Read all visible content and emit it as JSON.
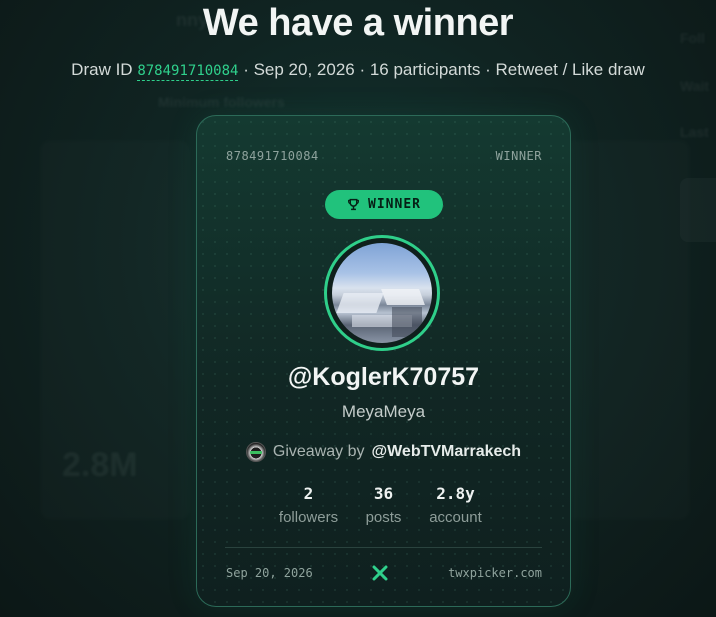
{
  "background_hints": {
    "ghost_1": "nny ac",
    "ghost_2": "Minimum followers",
    "ghost_3": "2.8M",
    "ghost_4": "Foll",
    "ghost_5": "Wait",
    "ghost_6": "Last"
  },
  "header": {
    "title": "We have a winner",
    "draw_id_prefix": "Draw ID",
    "draw_id": "878491710084",
    "meta": "· Sep 20, 2026 · 16 participants · Retweet / Like draw"
  },
  "card": {
    "draw_id": "878491710084",
    "corner_label": "WINNER",
    "badge_label": "WINNER",
    "badge_icon": "trophy-icon",
    "handle": "@KoglerK70757",
    "display_name": "MeyaMeya",
    "giveaway_prefix": "Giveaway by",
    "giveaway_host": "@WebTVMarrakech",
    "stats": [
      {
        "value": "2",
        "label": "followers"
      },
      {
        "value": "36",
        "label": "posts"
      },
      {
        "value": "2.8y",
        "label": "account"
      }
    ],
    "footer_date": "Sep 20, 2026",
    "footer_icon": "x-logo-icon",
    "footer_site": "twxpicker.com"
  },
  "colors": {
    "accent": "#21c27c",
    "draw_id": "#2fd08c",
    "card_border": "#2c6a58"
  }
}
